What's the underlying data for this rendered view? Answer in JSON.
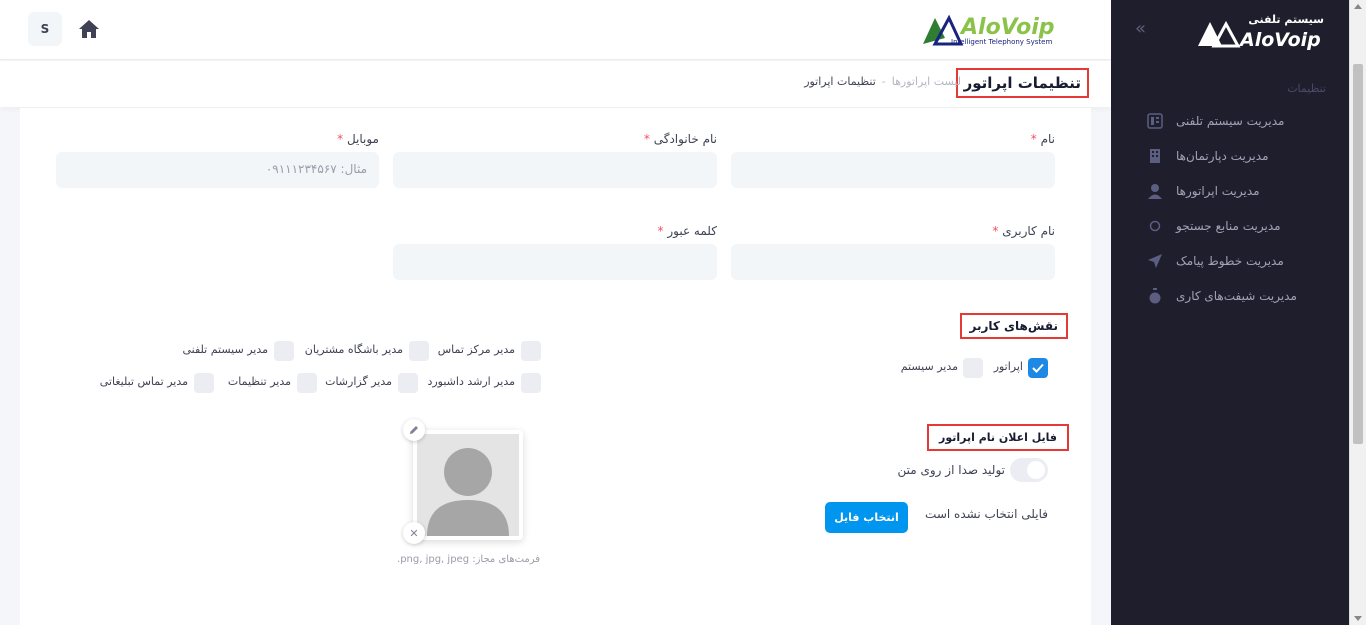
{
  "sidebar": {
    "logo_text": "سیستم تلفنی AloVoip",
    "collapse_icon": "double-chevron-left-icon",
    "section_label": "تنظیمات",
    "items": [
      {
        "label": "مدیریت سیستم تلفنی",
        "icon": "pbx-icon"
      },
      {
        "label": "مدیریت دپارتمان‌ها",
        "icon": "building-icon"
      },
      {
        "label": "مدیریت اپراتورها",
        "icon": "operator-icon"
      },
      {
        "label": "مدیریت منابع جستجو",
        "icon": "circle-icon"
      },
      {
        "label": "مدیریت خطوط پیامک",
        "icon": "send-icon"
      },
      {
        "label": "مدیریت شیفت‌های کاری",
        "icon": "timer-icon"
      }
    ]
  },
  "header": {
    "avatar_letter": "S",
    "brand_name": "AloVoip",
    "brand_tagline": "Intelligent Telephony System"
  },
  "subheader": {
    "title": "تنظیمات اپراتور",
    "breadcrumb": [
      "لیست اپراتورها",
      "-",
      "تنظیمات اپراتور"
    ]
  },
  "form": {
    "first_name": {
      "label": "نام",
      "value": ""
    },
    "last_name": {
      "label": "نام خانوادگی",
      "value": ""
    },
    "mobile": {
      "label": "موبایل",
      "placeholder": "مثال: ۰۹۱۱۱۲۳۴۵۶۷"
    },
    "username": {
      "label": "نام کاربری",
      "value": ""
    },
    "password": {
      "label": "کلمه عبور",
      "value": ""
    },
    "required_mark": "*"
  },
  "roles": {
    "title": "نقش‌های کاربر",
    "left_group": [
      {
        "label": "مدیر مرکز تماس",
        "checked": false
      },
      {
        "label": "مدیر باشگاه مشتریان",
        "checked": false
      },
      {
        "label": "مدیر سیستم تلفنی",
        "checked": false
      },
      {
        "label": "مدیر ارشد داشبورد",
        "checked": false
      },
      {
        "label": "مدیر گزارشات",
        "checked": false
      },
      {
        "label": "مدیر تنظیمات",
        "checked": false
      },
      {
        "label": "مدیر تماس تبلیغاتی",
        "checked": false
      }
    ],
    "right_group": [
      {
        "label": "اپراتور",
        "checked": true
      },
      {
        "label": "مدیر سیستم",
        "checked": false
      }
    ]
  },
  "announcement": {
    "title": "فایل اعلان نام اپراتور",
    "tts_label": "تولید صدا از روی متن",
    "tts_enabled": false,
    "no_file_text": "فایلی انتخاب نشده است",
    "choose_file_label": "انتخاب فایل"
  },
  "avatar_upload": {
    "formats_text": "فرمت‌های مجاز: png, jpg, jpeg.",
    "edit_icon": "pencil-icon",
    "remove_icon": "close-icon"
  },
  "colors": {
    "sidebar_bg": "#1e1e2d",
    "primary": "#0096f0",
    "checkbox_checked": "#1e88e5",
    "highlight_border": "#e53935",
    "required": "#f64e60"
  }
}
